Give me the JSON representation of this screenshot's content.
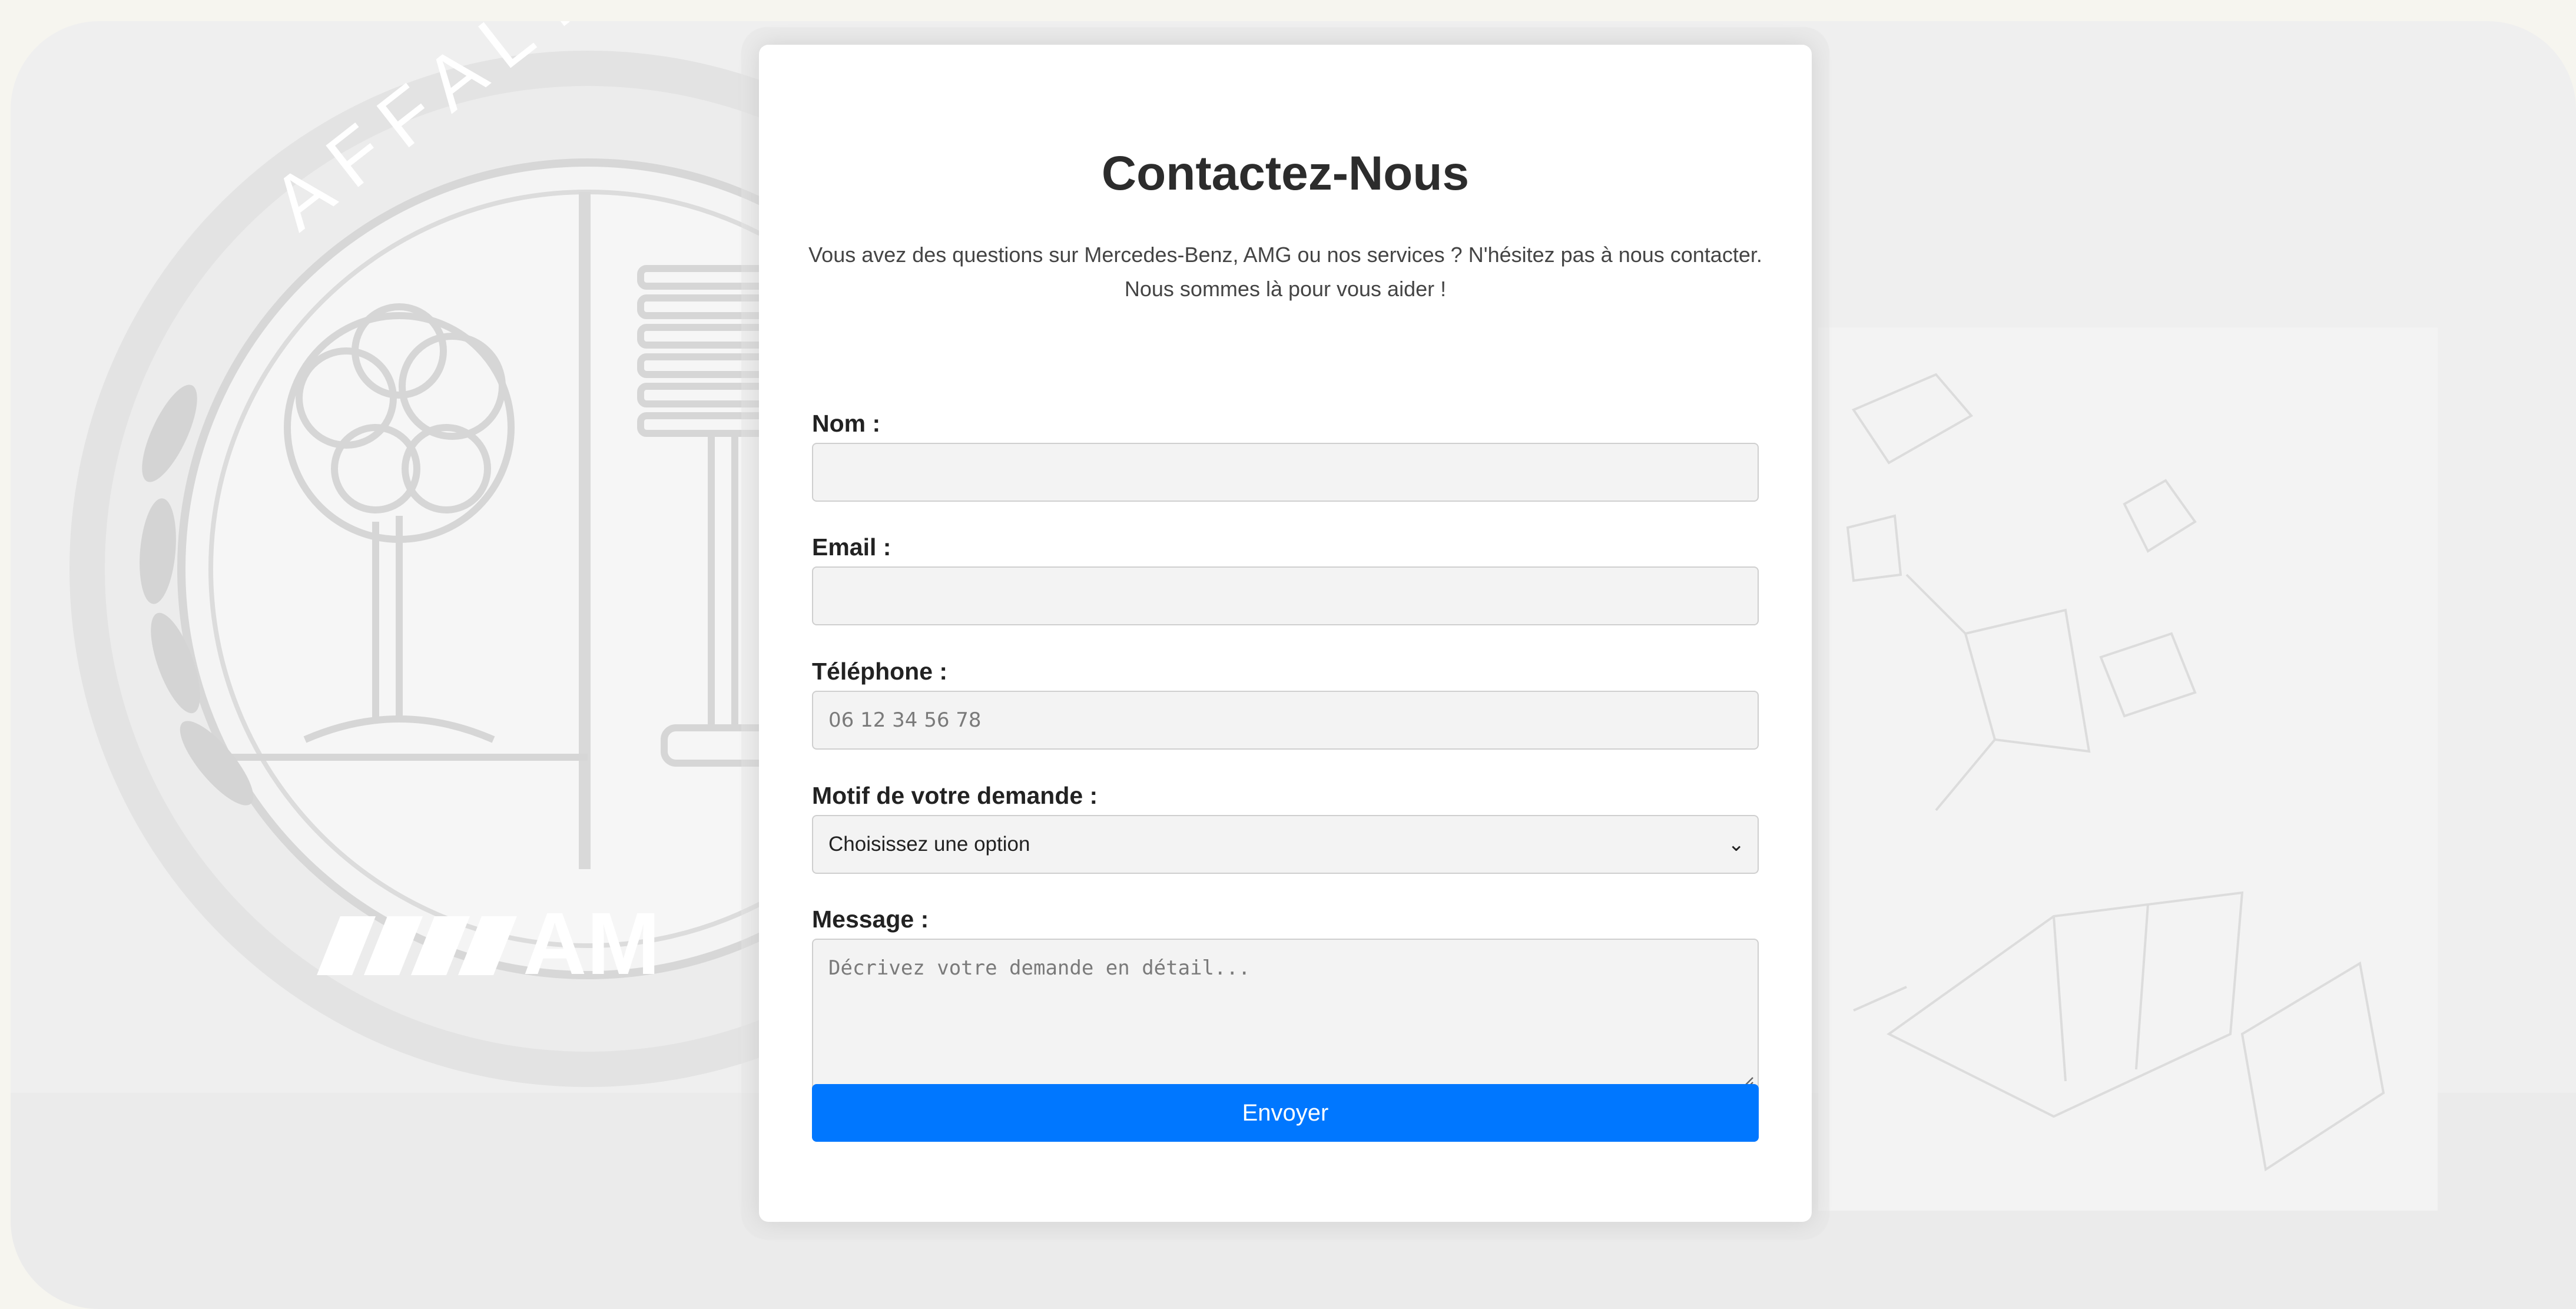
{
  "background": {
    "logo_ring_text": "AFFALTERB",
    "logo_word": "AM"
  },
  "form": {
    "title": "Contactez-Nous",
    "intro_line1": "Vous avez des questions sur Mercedes-Benz, AMG ou nos services ? N'hésitez pas à nous contacter.",
    "intro_line2": "Nous sommes là pour vous aider !",
    "name_label": "Nom :",
    "name_value": "",
    "email_label": "Email :",
    "email_value": "",
    "phone_label": "Téléphone :",
    "phone_placeholder": "06 12 34 56 78",
    "reason_label": "Motif de votre demande :",
    "reason_selected": "Choisissez une option",
    "message_label": "Message :",
    "message_placeholder": "Décrivez votre demande en détail...",
    "submit_label": "Envoyer"
  },
  "colors": {
    "submit_button": "#0077ff",
    "card": "#ffffff",
    "field": "#f3f3f3"
  }
}
